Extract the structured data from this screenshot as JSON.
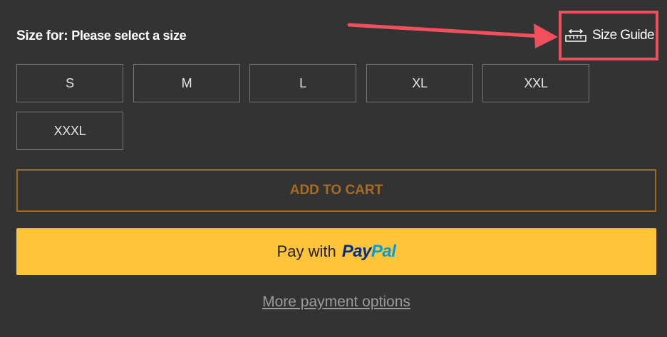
{
  "size_selector": {
    "label": "Size for:",
    "value": "Please select a size",
    "options": [
      "S",
      "M",
      "L",
      "XL",
      "XXL",
      "XXXL"
    ]
  },
  "size_guide": {
    "label": "Size Guide",
    "icon": "ruler-icon",
    "highlight_color": "#f0505e"
  },
  "cart": {
    "add_to_cart_label": "ADD TO CART"
  },
  "paypal": {
    "prefix": "Pay with",
    "logo_pay": "Pay",
    "logo_pal": "Pal",
    "background": "#ffc439"
  },
  "more_payment_options": "More payment options",
  "colors": {
    "page_background": "#333333",
    "add_to_cart_border": "#a06a1e"
  }
}
